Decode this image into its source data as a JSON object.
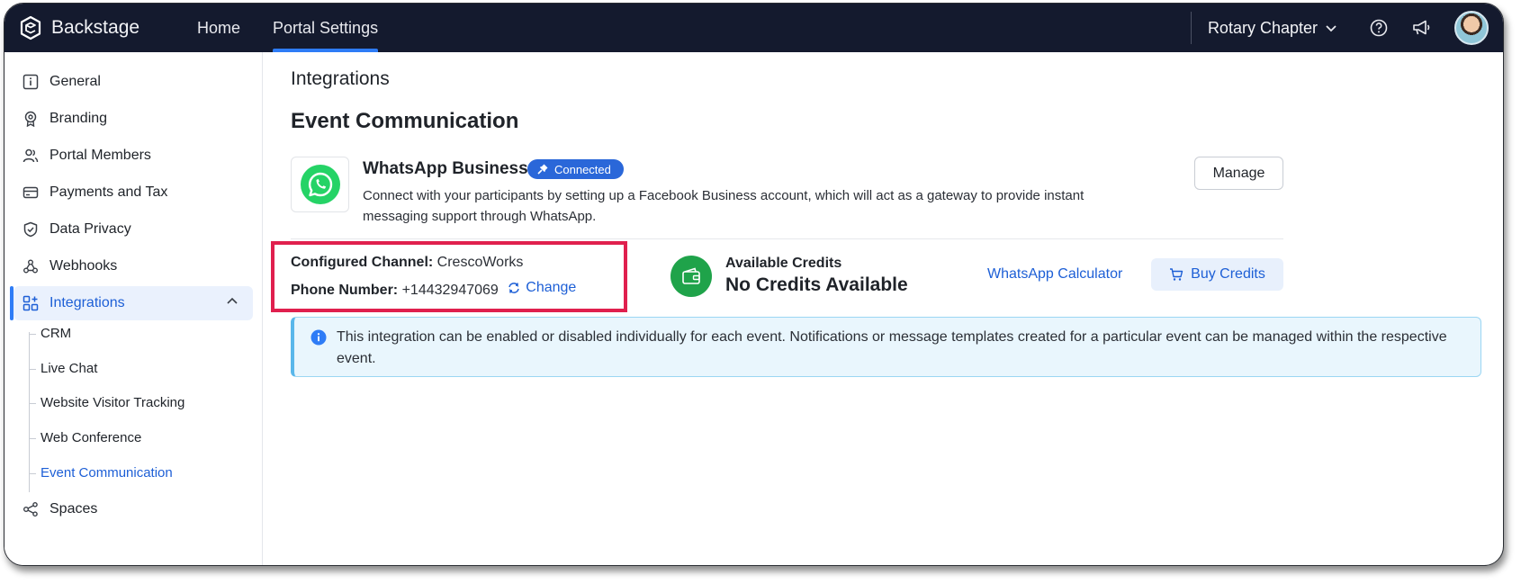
{
  "app": {
    "name": "Backstage"
  },
  "nav": [
    {
      "label": "Home",
      "active": false
    },
    {
      "label": "Portal Settings",
      "active": true
    }
  ],
  "header": {
    "org_name": "Rotary Chapter"
  },
  "sidebar": {
    "items": [
      {
        "label": "General",
        "icon": "info-square-icon"
      },
      {
        "label": "Branding",
        "icon": "badge-icon"
      },
      {
        "label": "Portal Members",
        "icon": "members-icon"
      },
      {
        "label": "Payments and Tax",
        "icon": "card-icon"
      },
      {
        "label": "Data Privacy",
        "icon": "shield-icon"
      },
      {
        "label": "Webhooks",
        "icon": "webhook-icon"
      },
      {
        "label": "Integrations",
        "icon": "integrations-icon",
        "active": true
      },
      {
        "label": "Spaces",
        "icon": "spaces-icon"
      }
    ],
    "sub_items": [
      {
        "label": "CRM"
      },
      {
        "label": "Live Chat"
      },
      {
        "label": "Website Visitor Tracking"
      },
      {
        "label": "Web Conference"
      },
      {
        "label": "Event Communication",
        "active": true
      }
    ]
  },
  "main": {
    "page_heading": "Integrations",
    "section_title": "Event Communication",
    "integration": {
      "name": "WhatsApp Business",
      "status": "Connected",
      "description": "Connect with your participants by setting up a Facebook Business account, which will act as a gateway to provide instant messaging support through WhatsApp.",
      "manage_label": "Manage"
    },
    "config": {
      "channel_label": "Configured Channel:",
      "channel_value": "CrescoWorks",
      "phone_label": "Phone Number:",
      "phone_value": "+14432947069",
      "change_label": "Change"
    },
    "credits": {
      "label": "Available Credits",
      "value": "No Credits Available",
      "calculator_label": "WhatsApp Calculator",
      "buy_label": "Buy Credits"
    },
    "info": "This integration can be enabled or disabled individually for each event. Notifications or message templates created for a particular event can be managed within the respective event."
  },
  "colors": {
    "topbar": "#141a2e",
    "accent": "#2e7cf6",
    "link": "#1d5fd6",
    "whatsapp": "#25d366",
    "credits": "#1fa34a",
    "highlight": "#e0204e"
  }
}
